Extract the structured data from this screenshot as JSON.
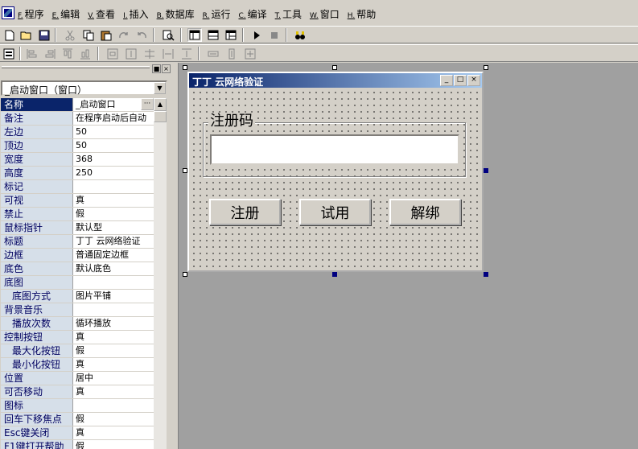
{
  "menu": {
    "items": [
      {
        "accel": "F.",
        "label": "程序"
      },
      {
        "accel": "E.",
        "label": "编辑"
      },
      {
        "accel": "V.",
        "label": "查看"
      },
      {
        "accel": "I.",
        "label": "插入"
      },
      {
        "accel": "B.",
        "label": "数据库"
      },
      {
        "accel": "R.",
        "label": "运行"
      },
      {
        "accel": "C.",
        "label": "编译"
      },
      {
        "accel": "T.",
        "label": "工具"
      },
      {
        "accel": "W.",
        "label": "窗口"
      },
      {
        "accel": "H.",
        "label": "帮助"
      }
    ]
  },
  "toolbar1": {
    "icons": [
      "new-file-icon",
      "open-folder-icon",
      "save-icon",
      "cut-icon",
      "copy-icon",
      "paste-icon",
      "redo-icon",
      "undo-icon",
      "find-icon",
      "layout1-icon",
      "layout2-icon",
      "layout3-icon",
      "run-icon",
      "stop-icon",
      "debug-icon"
    ]
  },
  "toolbar2": {
    "icons": [
      "form-icon",
      "align-left-icon",
      "align-right-icon",
      "align-top-icon",
      "align-bottom-icon",
      "center-h-icon",
      "center-v-icon",
      "same-width-icon",
      "space-h-icon",
      "space-v-icon",
      "resize-h-icon",
      "resize-v-icon",
      "resize-both-icon"
    ]
  },
  "panel": {
    "object_selector": "_启动窗口（窗口）",
    "pin_glyph": "■",
    "close_glyph": "×",
    "dropdown_arrow": "▼",
    "scroll_up": "▲",
    "ellipsis": "···",
    "properties": [
      {
        "name": "名称",
        "value": "_启动窗口",
        "selected": true
      },
      {
        "name": "备注",
        "value": "在程序启动后自动"
      },
      {
        "name": "左边",
        "value": "50"
      },
      {
        "name": "顶边",
        "value": "50"
      },
      {
        "name": "宽度",
        "value": "368"
      },
      {
        "name": "高度",
        "value": "250"
      },
      {
        "name": "标记",
        "value": ""
      },
      {
        "name": "可视",
        "value": "真"
      },
      {
        "name": "禁止",
        "value": "假"
      },
      {
        "name": "鼠标指针",
        "value": "默认型"
      },
      {
        "name": "标题",
        "value": "丁丁 云网络验证"
      },
      {
        "name": "边框",
        "value": "普通固定边框"
      },
      {
        "name": "底色",
        "value": "默认底色"
      },
      {
        "name": "底图",
        "value": ""
      },
      {
        "name": "底图方式",
        "value": "图片平铺",
        "sub": true
      },
      {
        "name": "背景音乐",
        "value": ""
      },
      {
        "name": "播放次数",
        "value": "循环播放",
        "sub": true
      },
      {
        "name": "控制按钮",
        "value": "真"
      },
      {
        "name": "最大化按钮",
        "value": "假",
        "sub": true
      },
      {
        "name": "最小化按钮",
        "value": "真",
        "sub": true
      },
      {
        "name": "位置",
        "value": "居中"
      },
      {
        "name": "可否移动",
        "value": "真"
      },
      {
        "name": "图标",
        "value": ""
      },
      {
        "name": "回车下移焦点",
        "value": "假"
      },
      {
        "name": "Esc键关闭",
        "value": "真"
      },
      {
        "name": "F1键打开帮助",
        "value": "假"
      }
    ]
  },
  "form": {
    "title": "丁丁 云网络验证",
    "minimize_glyph": "_",
    "maximize_glyph": "□",
    "close_glyph": "×",
    "group_label": "注册码",
    "input_value": "",
    "buttons": {
      "register": "注册",
      "trial": "试用",
      "unbind": "解绑"
    }
  },
  "colors": {
    "face": "#d4d0c8",
    "titlebar_start": "#0a246a",
    "titlebar_end": "#a6caf0",
    "property_name_bg": "#d6dfe9",
    "design_bg": "#a0a0a0"
  }
}
